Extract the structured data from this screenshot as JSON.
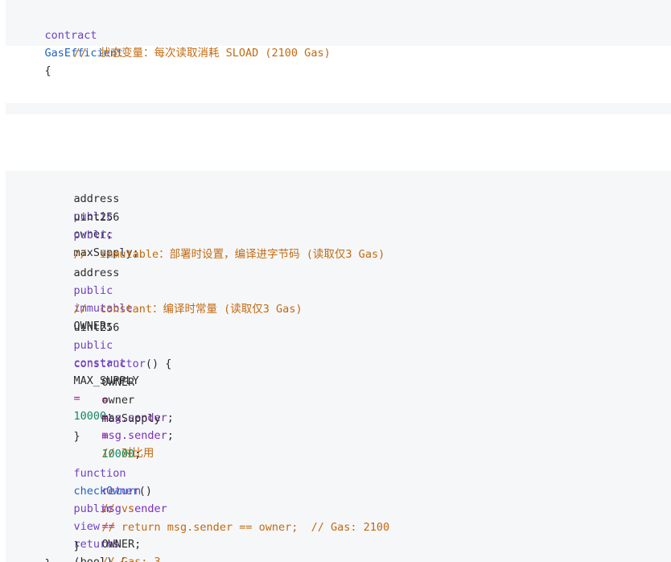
{
  "top_block": {
    "line1": {
      "kw": "contract",
      "name": "GasEfficient",
      "brace": "{"
    },
    "line2": {
      "comment": "//  状态变量：每次读取消耗 SLOAD (2100 Gas)"
    }
  },
  "bottom_block": {
    "lines": [
      {
        "type": "address",
        "mod": "public",
        "rest": "owner;"
      },
      {
        "type": "uint256",
        "mod": "public",
        "rest": "maxSupply;"
      },
      {
        "comment": "//  immutable：部署时设置，编译进字节码 (读取仅3 Gas)"
      },
      {
        "type": "address",
        "mod": "public",
        "mod2": "immutable",
        "rest": "OWNER;"
      },
      {
        "comment": "//  constant：编译时常量 (读取仅3 Gas)"
      },
      {
        "type": "uint256",
        "mod": "public",
        "mod2": "constant",
        "name": "MAX_SUPPLY",
        "op": "=",
        "num": "10000",
        "end": ";"
      },
      {
        "fn": "constructor",
        "rest": "() {"
      },
      {
        "lhs": "OWNER",
        "op": "=",
        "rhs": "msg.sender",
        "end": ";"
      },
      {
        "lhs": "owner",
        "op": "=",
        "rhs": "msg.sender",
        "end": ";",
        "comment": "// 对比用"
      },
      {
        "lhs": "maxSupply",
        "op": "=",
        "num": "10000",
        "end": ";"
      },
      {
        "plain": "}"
      },
      {
        "kw": "function",
        "name": "checkOwner",
        "rest1": "()",
        "kw2": "public",
        "kw3": "view",
        "kw4": "returns",
        "paren_open": "(",
        "type": "bool",
        "paren_close": ") {"
      },
      {
        "kw": "return",
        "expr": "msg.sender",
        "op": "==",
        "rest": "OWNER;",
        "comment": "// Gas: 3"
      },
      {
        "comment": "// vs"
      },
      {
        "comment": "// return msg.sender == owner;  // Gas: 2100"
      },
      {
        "plain": "}"
      },
      {
        "plain": "}"
      }
    ]
  }
}
